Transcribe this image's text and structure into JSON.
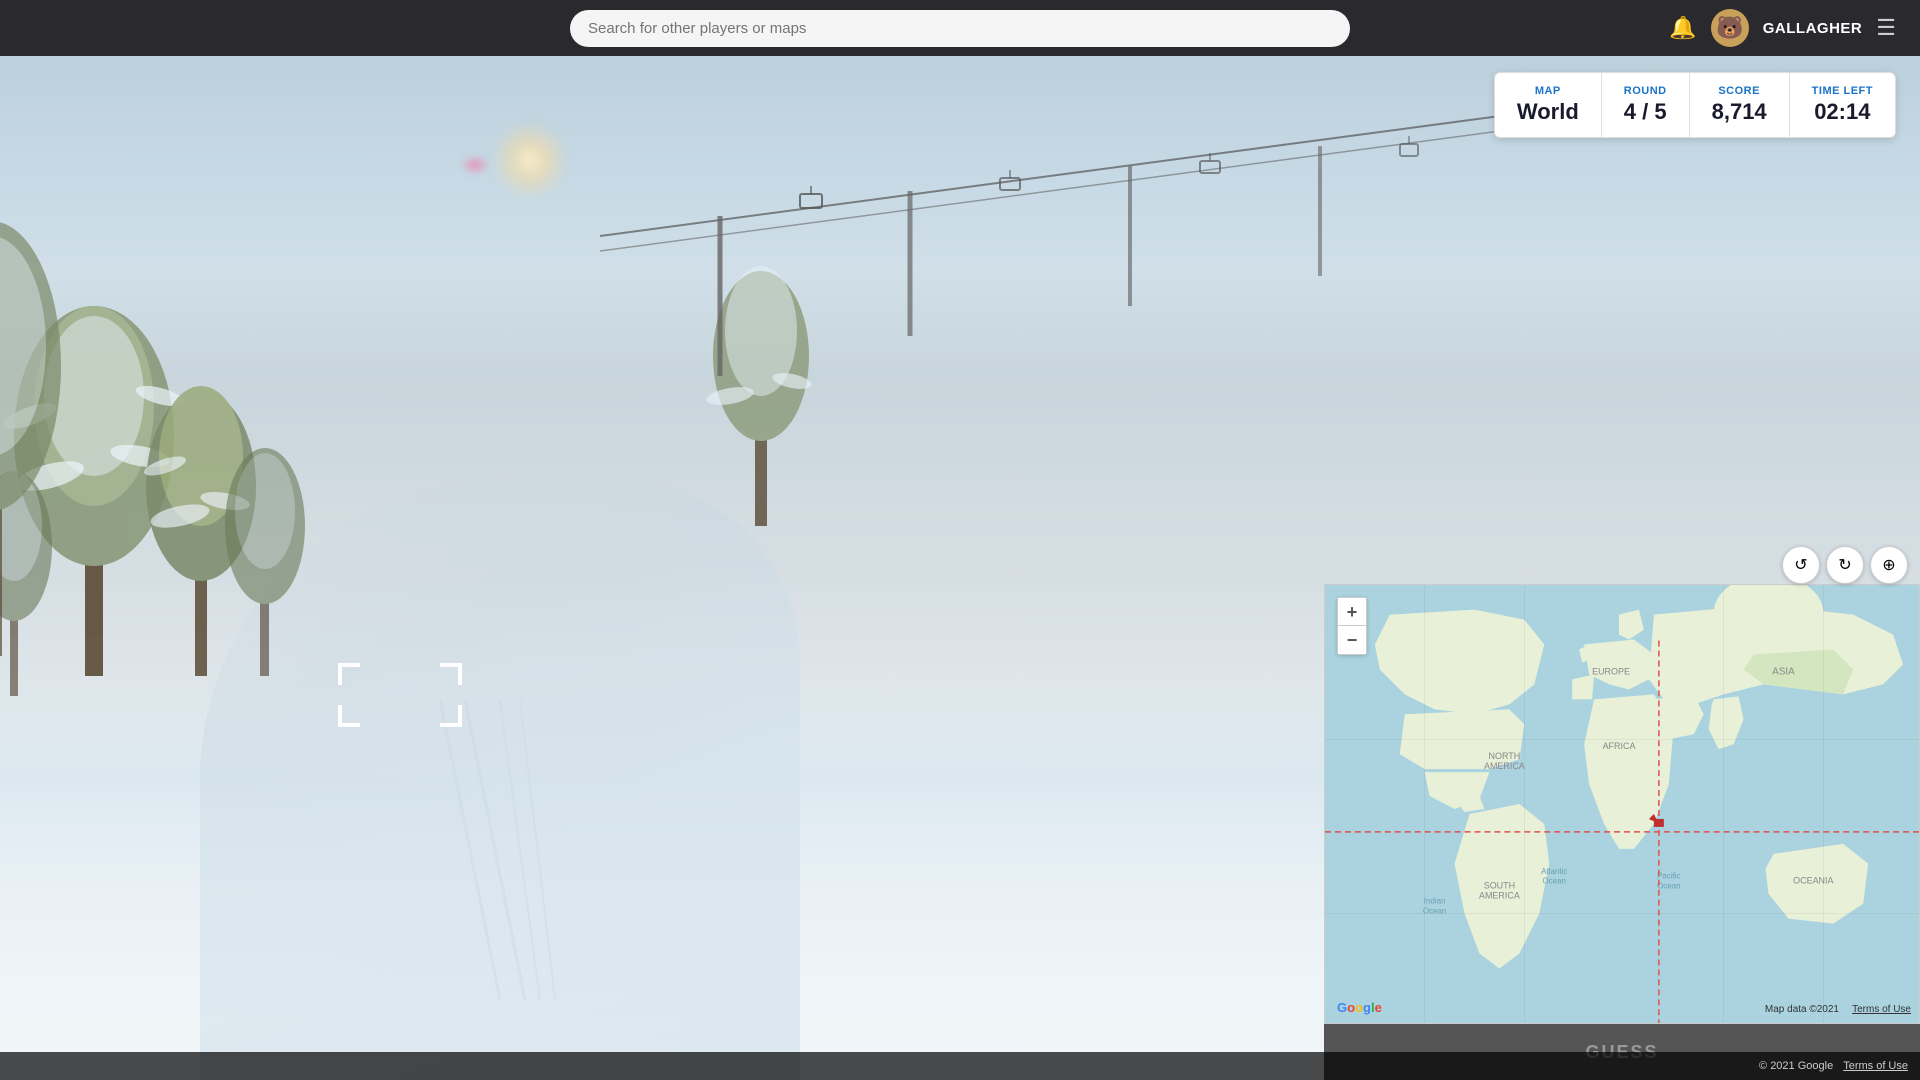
{
  "topbar": {
    "search_placeholder": "Search for other players or maps",
    "username": "GALLAGHER"
  },
  "hud": {
    "map_label": "MAP",
    "map_value": "World",
    "round_label": "ROUND",
    "round_value": "4 / 5",
    "score_label": "SCORE",
    "score_value": "8,714",
    "time_label": "TIME LEFT",
    "time_value": "02:14"
  },
  "map": {
    "zoom_in_label": "+",
    "zoom_out_label": "−",
    "data_text": "Map data ©2021",
    "terms_text": "Terms of Use",
    "google_text": "Google"
  },
  "controls": {
    "rotate_left_icon": "↺",
    "rotate_right_icon": "↻",
    "reset_icon": "⊕"
  },
  "guess_button": {
    "label": "GUESS"
  },
  "bottom_bar": {
    "copyright": "© 2021 Google",
    "terms": "Terms of Use"
  },
  "colors": {
    "accent_blue": "#1a73c8",
    "background_dark": "#2a2a2e",
    "map_water": "#aad3df",
    "map_land": "#e8f0d8",
    "map_land2": "#d4e6c0"
  }
}
